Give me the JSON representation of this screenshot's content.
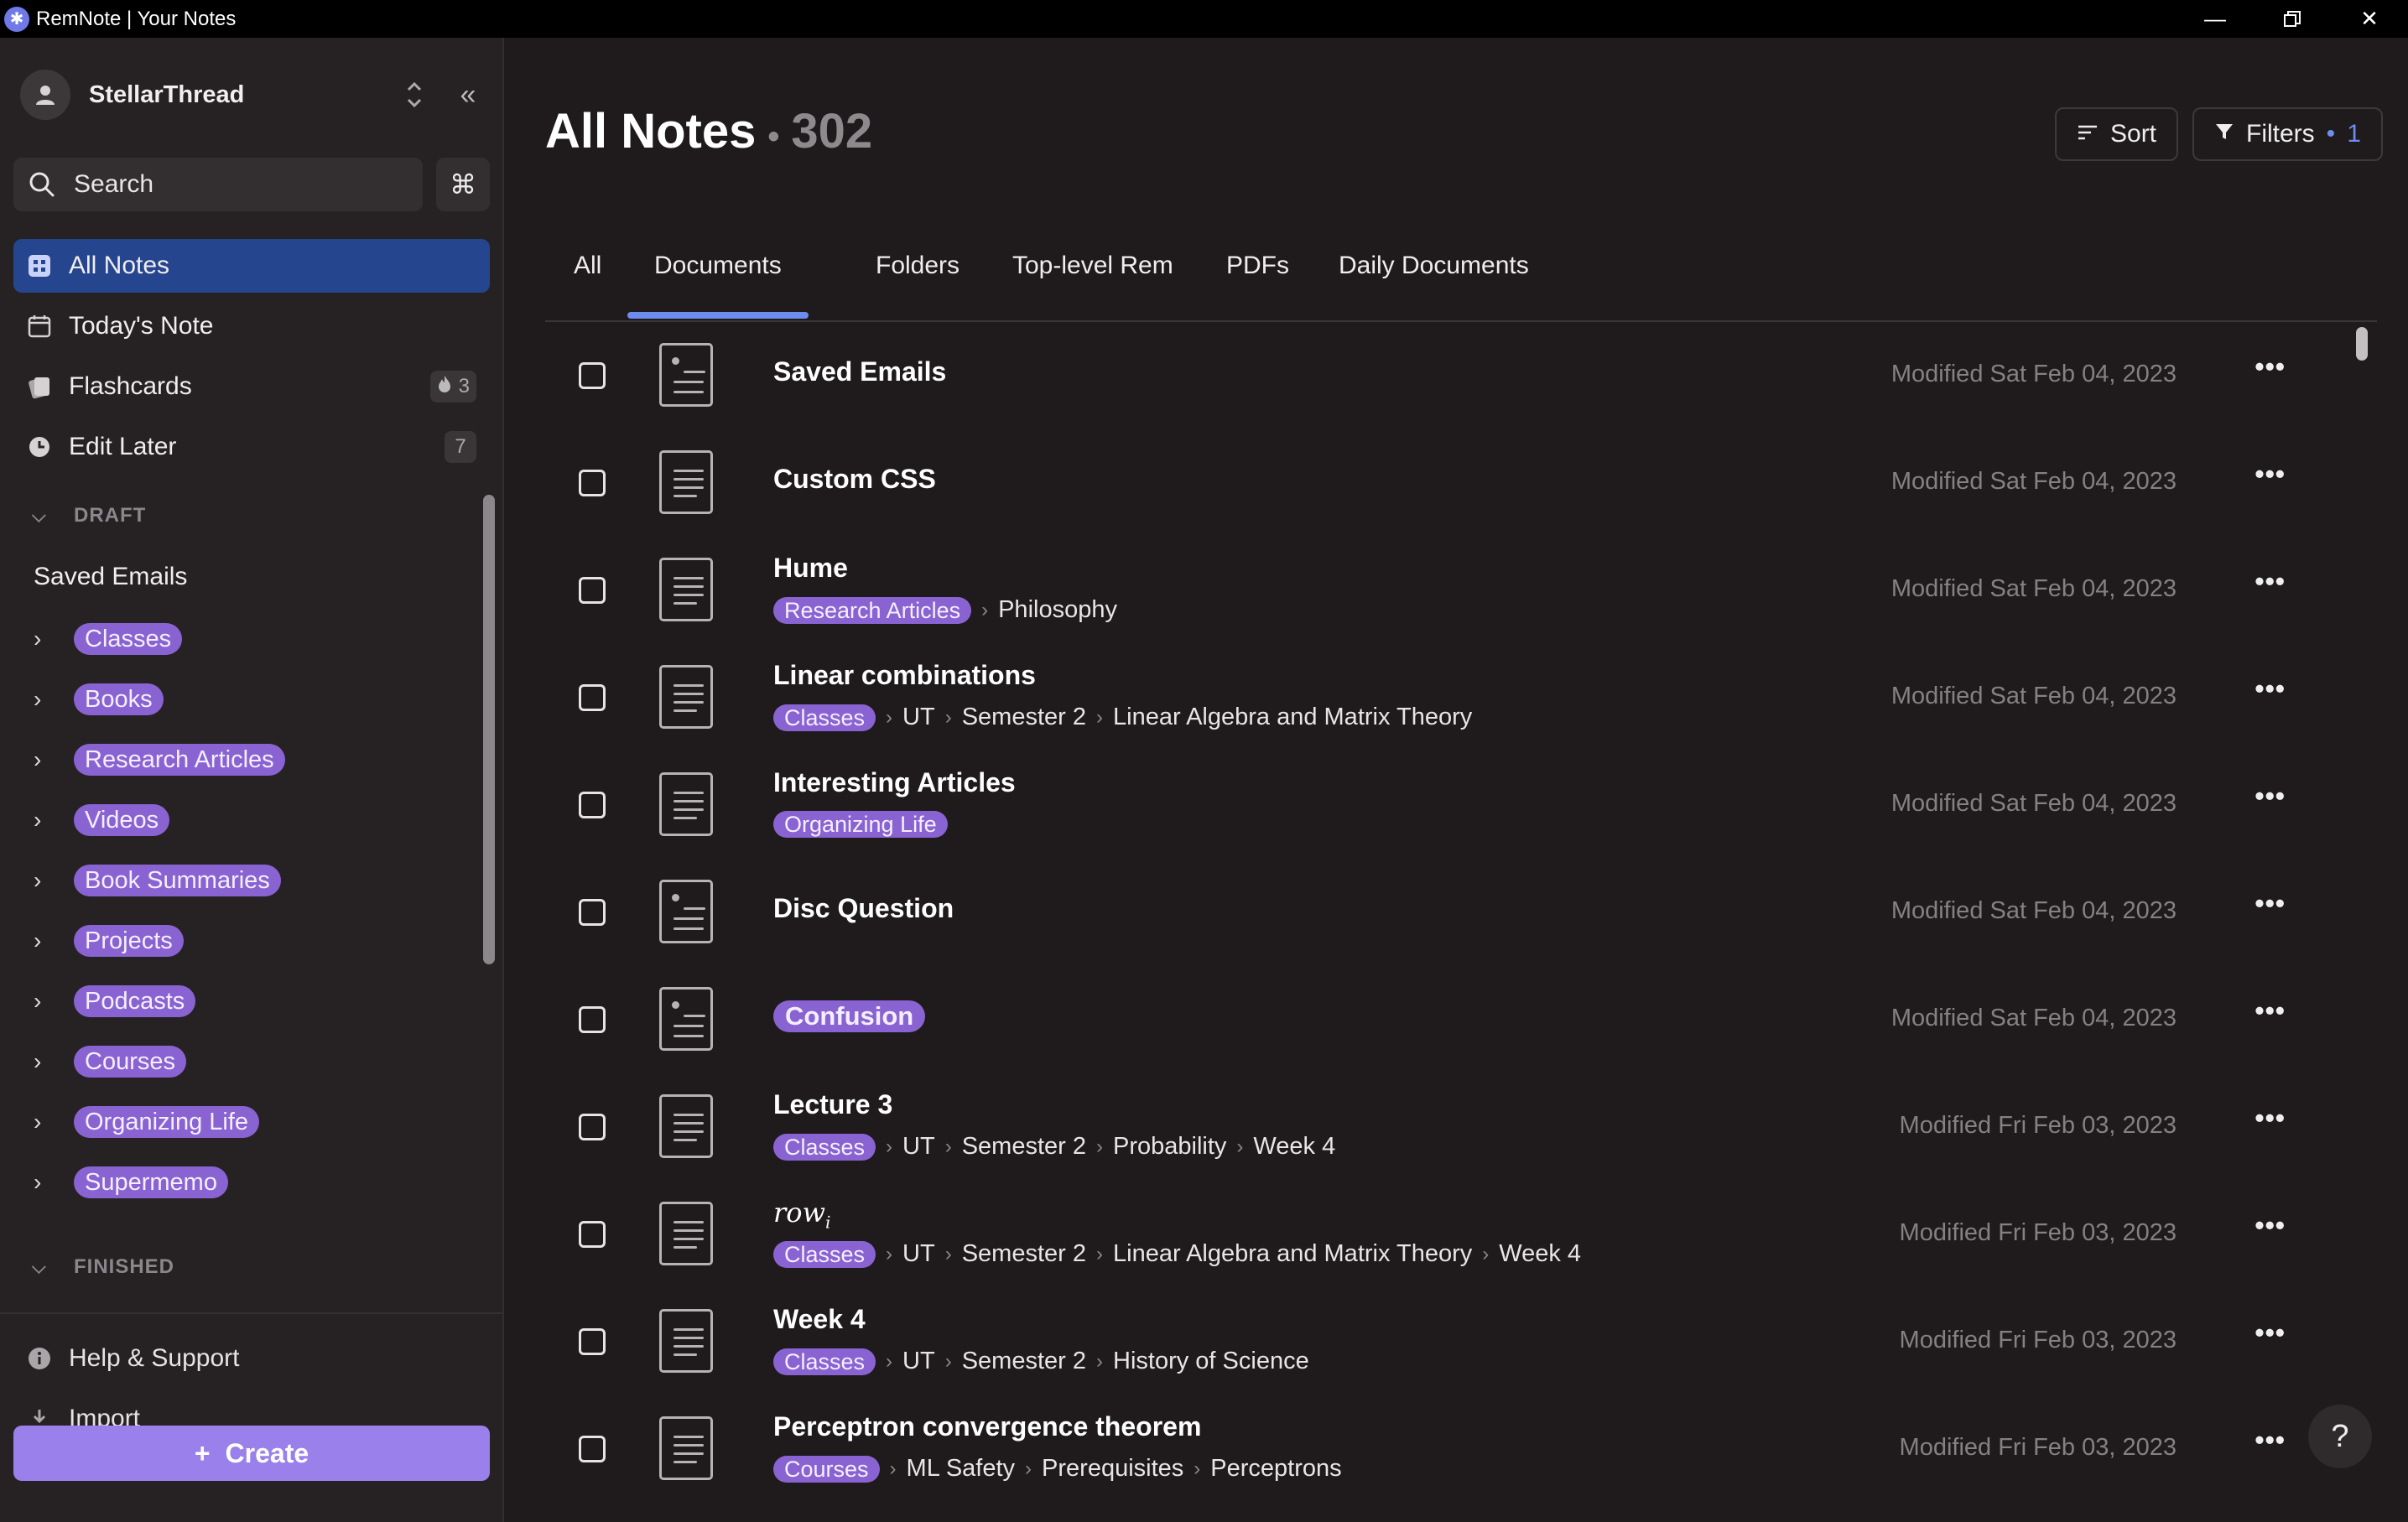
{
  "window": {
    "title": "RemNote | Your Notes",
    "controls": [
      "minimize",
      "restore",
      "close"
    ]
  },
  "sidebar": {
    "account_name": "StellarThread",
    "search_label": "Search",
    "command_key": "⌘",
    "nav": [
      {
        "label": "All Notes",
        "icon": "grid-icon",
        "active": true
      },
      {
        "label": "Today's Note",
        "icon": "calendar-icon"
      },
      {
        "label": "Flashcards",
        "icon": "cards-icon",
        "badge": "3",
        "badge_icon": "flame-icon"
      },
      {
        "label": "Edit Later",
        "icon": "clock-icon",
        "badge": "7"
      }
    ],
    "draft_header": "DRAFT",
    "draft_doc": "Saved Emails",
    "tree": [
      "Classes",
      "Books",
      "Research Articles",
      "Videos",
      "Book Summaries",
      "Projects",
      "Podcasts",
      "Courses",
      "Organizing Life",
      "Supermemo"
    ],
    "finished_header": "FINISHED",
    "footer": [
      {
        "label": "Help & Support",
        "icon": "info-icon"
      },
      {
        "label": "Import",
        "icon": "download-icon"
      }
    ],
    "create_label": "Create"
  },
  "main": {
    "title": "All Notes",
    "count": "302",
    "sort_label": "Sort",
    "filters_label": "Filters",
    "filters_count": "1",
    "tabs": [
      "All",
      "Documents",
      "Folders",
      "Top-level Rem",
      "PDFs",
      "Daily Documents"
    ],
    "active_tab": "Documents",
    "rows": [
      {
        "title": "Saved Emails",
        "crumbs": [],
        "modified": "Modified Sat Feb 04, 2023",
        "icon": "doc-bullet"
      },
      {
        "title": "Custom CSS",
        "crumbs": [],
        "modified": "Modified Sat Feb 04, 2023",
        "icon": "doc-lines"
      },
      {
        "title": "Hume",
        "crumbs": [
          "Research Articles",
          "Philosophy"
        ],
        "modified": "Modified Sat Feb 04, 2023",
        "icon": "doc-lines"
      },
      {
        "title": "Linear combinations",
        "crumbs": [
          "Classes",
          "UT",
          "Semester 2",
          "Linear Algebra and Matrix Theory"
        ],
        "modified": "Modified Sat Feb 04, 2023",
        "icon": "doc-lines"
      },
      {
        "title": "Interesting Articles",
        "crumbs": [
          "Organizing Life"
        ],
        "modified": "Modified Sat Feb 04, 2023",
        "icon": "doc-lines"
      },
      {
        "title": "Disc Question",
        "crumbs": [],
        "modified": "Modified Sat Feb 04, 2023",
        "icon": "doc-bullet"
      },
      {
        "title": "Confusion",
        "crumbs": [],
        "modified": "Modified Sat Feb 04, 2023",
        "icon": "doc-bullet",
        "tagged": true
      },
      {
        "title": "Lecture 3",
        "crumbs": [
          "Classes",
          "UT",
          "Semester 2",
          "Probability",
          "Week 4"
        ],
        "modified": "Modified Fri Feb 03, 2023",
        "icon": "doc-lines"
      },
      {
        "title": "row",
        "title_sub": "i",
        "math": true,
        "crumbs": [
          "Classes",
          "UT",
          "Semester 2",
          "Linear Algebra and Matrix Theory",
          "Week 4"
        ],
        "modified": "Modified Fri Feb 03, 2023",
        "icon": "doc-lines"
      },
      {
        "title": "Week 4",
        "crumbs": [
          "Classes",
          "UT",
          "Semester 2",
          "History of Science"
        ],
        "modified": "Modified Fri Feb 03, 2023",
        "icon": "doc-lines"
      },
      {
        "title": "Perceptron convergence theorem",
        "crumbs": [
          "Courses",
          "ML Safety",
          "Prerequisites",
          "Perceptrons"
        ],
        "modified": "Modified Fri Feb 03, 2023",
        "icon": "doc-lines"
      }
    ],
    "more_label": "•••",
    "help_label": "?"
  },
  "colors": {
    "accent": "#6d8cf0",
    "tag": "#8a63d2",
    "active_nav": "#26458f",
    "create": "#9a80ea"
  }
}
